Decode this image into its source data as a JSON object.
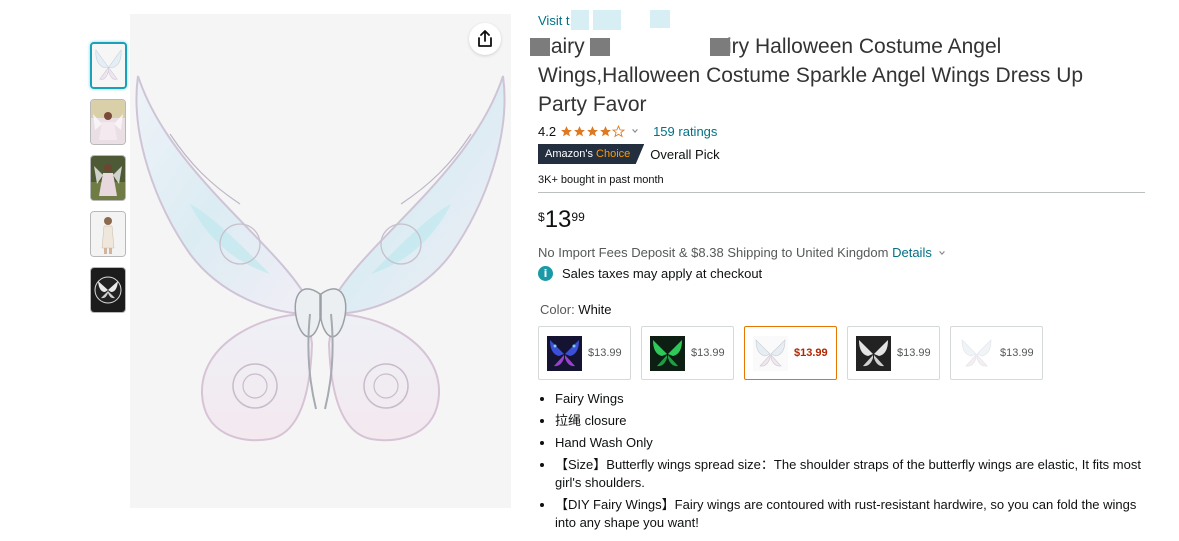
{
  "product": {
    "visit_text": "Visit t",
    "title_line1": "Fairy W            ty Fairy Halloween Costume Angel",
    "title_line2": "Wings,Halloween Costume Sparkle Angel Wings Dress Up",
    "title_line3": "Party Favor",
    "rating_value": "4.2",
    "ratings_count": "159 ratings",
    "badge_prefix": "Amazon's ",
    "badge_choice": "Choice",
    "badge_pick": "Overall Pick",
    "bought": "3K+ bought in past month",
    "price": {
      "symbol": "$",
      "whole": "13",
      "fraction": "99"
    },
    "shipping_text": "No Import Fees Deposit & $8.38 Shipping to United Kingdom ",
    "shipping_details": "Details",
    "tax_text": "Sales taxes may apply at checkout",
    "info_icon": "i",
    "color_label": "Color: ",
    "color_value": "White"
  },
  "swatches": [
    {
      "price": "$13.99",
      "theme": "blue-lights"
    },
    {
      "price": "$13.99",
      "theme": "green-lights"
    },
    {
      "price": "$13.99",
      "theme": "white",
      "selected": true
    },
    {
      "price": "$13.99",
      "theme": "black"
    },
    {
      "price": "$13.99",
      "theme": "white-faded"
    }
  ],
  "bullets": [
    "Fairy Wings",
    "拉绳 closure",
    "Hand Wash Only",
    "【Size】Butterfly wings spread size：The shoulder straps of the butterfly wings are elastic, It fits most girl's shoulders.",
    "【DIY Fairy Wings】Fairy wings are contoured with rust-resistant hardwire, so you can fold the wings into any shape you want!"
  ],
  "icons": {
    "share": "share-icon",
    "chevron": "chevron-down-icon",
    "info": "info-icon",
    "star": "star-icon"
  },
  "colors": {
    "link": "#007185",
    "price_selected": "#b12704",
    "star": "#de7921",
    "badge_bg": "#232f3e",
    "badge_choice": "#ff9900",
    "thumb_active": "#1aa0b8"
  }
}
